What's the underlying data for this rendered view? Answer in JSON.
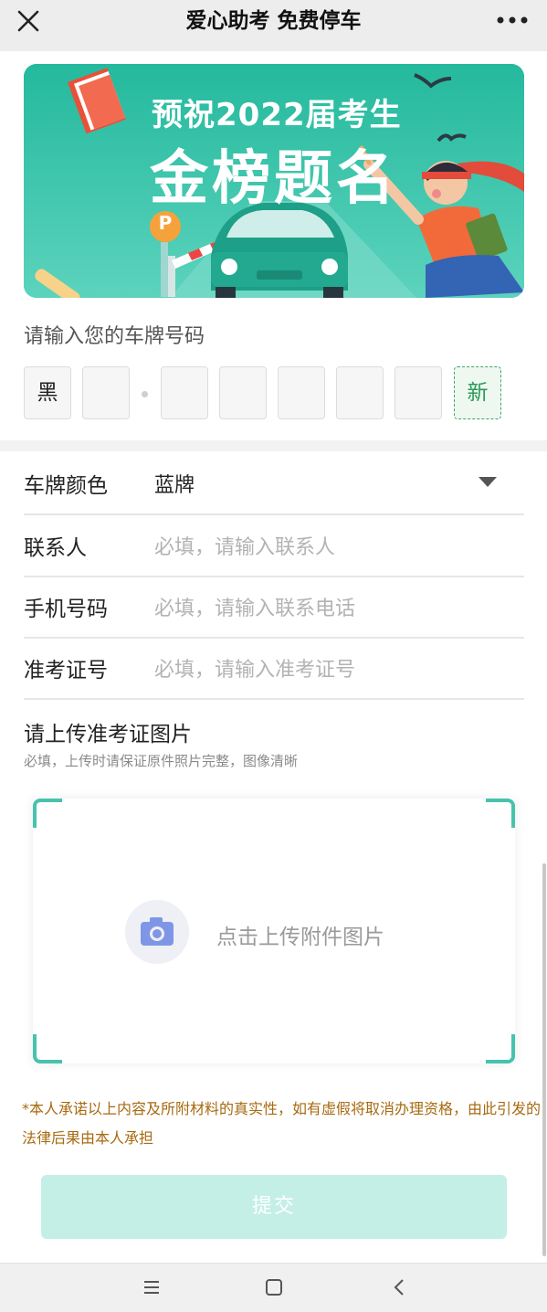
{
  "header": {
    "title": "爱心助考 免费停车"
  },
  "banner": {
    "line1": "预祝2022届考生",
    "line2": "金榜题名",
    "parking_sign": "P"
  },
  "plate": {
    "label": "请输入您的车牌号码",
    "province": "黑",
    "chars": [
      "",
      "",
      "",
      "",
      "",
      ""
    ],
    "first_char": "",
    "new_energy_label": "新"
  },
  "form": {
    "plate_color": {
      "label": "车牌颜色",
      "value": "蓝牌"
    },
    "contact": {
      "label": "联系人",
      "placeholder": "必填，请输入联系人"
    },
    "phone": {
      "label": "手机号码",
      "placeholder": "必填，请输入联系电话"
    },
    "ticket": {
      "label": "准考证号",
      "placeholder": "必填，请输入准考证号"
    }
  },
  "upload": {
    "title": "请上传准考证图片",
    "hint": "必填，上传时请保证原件照片完整，图像清晰",
    "button_text": "点击上传附件图片"
  },
  "notice": "*本人承诺以上内容及所附材料的真实性，如有虚假将取消办理资格，由此引发的法律后果由本人承担",
  "submit_label": "提交",
  "colors": {
    "accent": "#2cbda0",
    "submit_disabled": "#c3efe7",
    "notice": "#a76a10",
    "new_energy": "#2a9a55"
  },
  "icons": [
    "close-icon",
    "more-icon",
    "camera-icon",
    "menu-icon",
    "home-icon",
    "back-icon"
  ]
}
